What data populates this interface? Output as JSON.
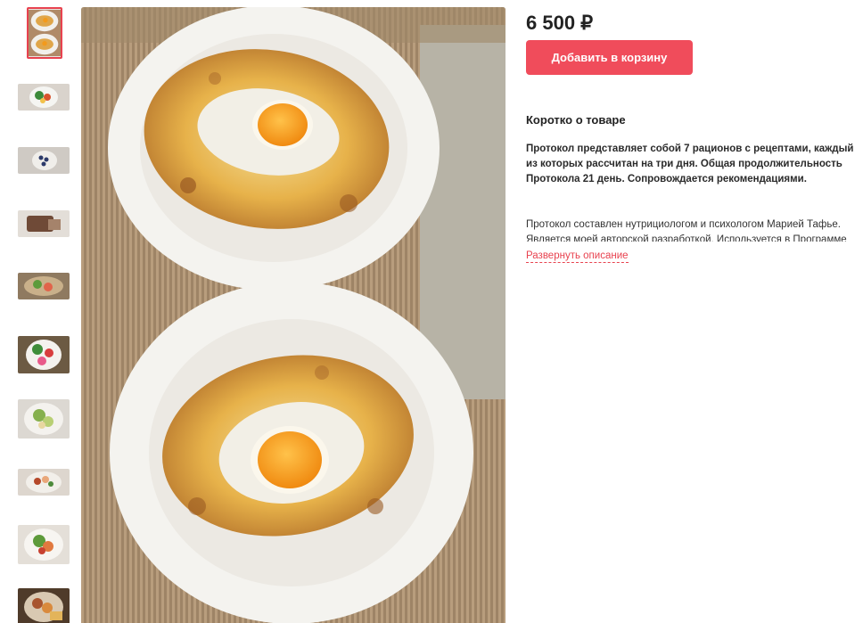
{
  "product": {
    "price": "6 500 ₽",
    "add_to_cart_label": "Добавить в корзину"
  },
  "description": {
    "short_title": "Коротко о товаре",
    "short_text": "Протокол представляет собой 7 рационов с рецептами, каждый из которых рассчитан на три дня. Общая продолжительность Протокола 21 день. Сопровождается рекомендациями.",
    "full_text_preview": "Протокол составлен нутрициологом и психологом Марией Тафье. Является моей авторской разработкой. Используется в Программе",
    "expand_label": "Развернуть описание"
  },
  "gallery": {
    "thumbnails": [
      {
        "name": "thumb-khachapuri",
        "active": true
      },
      {
        "name": "thumb-plate-vegetables"
      },
      {
        "name": "thumb-blueberries"
      },
      {
        "name": "thumb-bread-slice"
      },
      {
        "name": "thumb-salad-board"
      },
      {
        "name": "thumb-vegetable-plate"
      },
      {
        "name": "thumb-green-salad"
      },
      {
        "name": "thumb-plated-meal"
      },
      {
        "name": "thumb-plate-salad-2"
      },
      {
        "name": "thumb-stew"
      }
    ]
  }
}
